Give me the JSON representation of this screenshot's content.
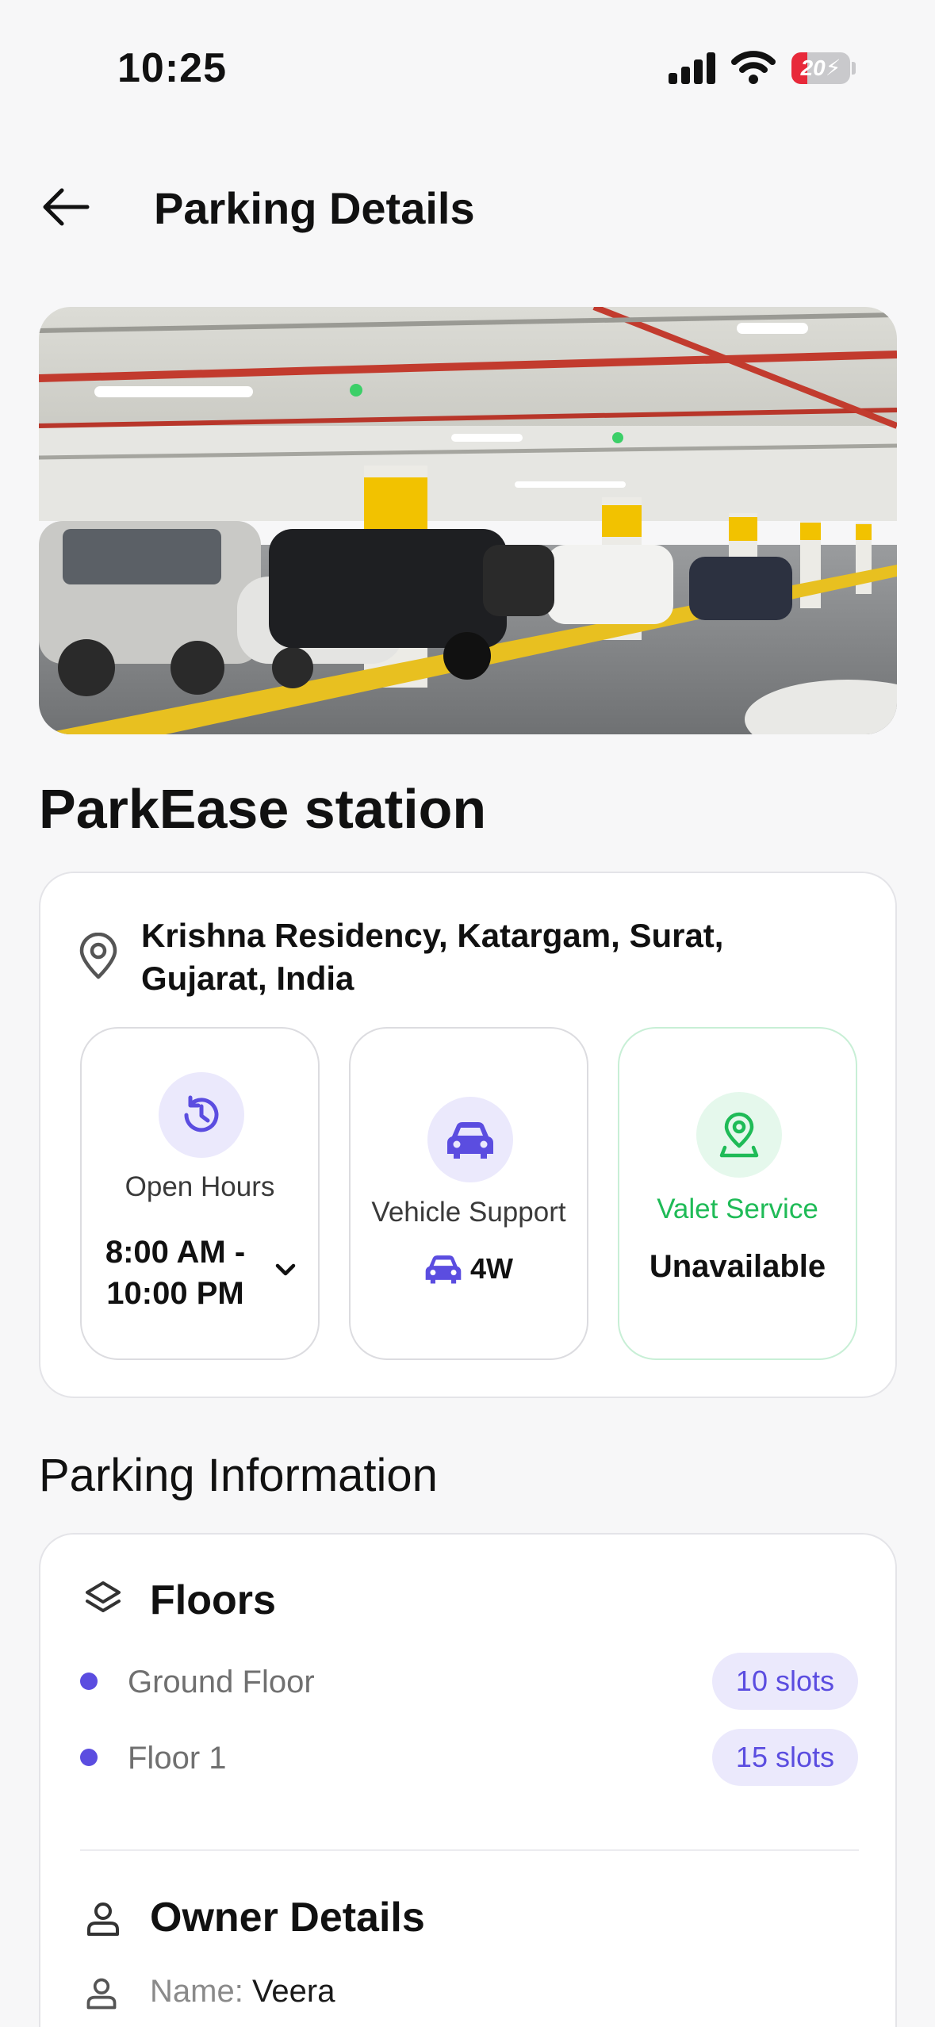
{
  "status_bar": {
    "time": "10:25",
    "battery": "20"
  },
  "header": {
    "title": "Parking Details"
  },
  "station": {
    "name": "ParkEase station"
  },
  "location": {
    "address": "Krishna Residency, Katargam, Surat, Gujarat, India",
    "tiles": {
      "hours": {
        "label": "Open Hours",
        "value": "8:00 AM - 10:00 PM"
      },
      "vehicle": {
        "label": "Vehicle Support",
        "value": "4W"
      },
      "valet": {
        "label": "Valet Service",
        "value": "Unavailable"
      }
    }
  },
  "parking_info": {
    "section_title": "Parking Information",
    "floors_title": "Floors",
    "floors": [
      {
        "name": "Ground Floor",
        "slots": "10 slots"
      },
      {
        "name": "Floor 1",
        "slots": "15 slots"
      }
    ],
    "owner_title": "Owner Details",
    "owner_name_label": "Name:",
    "owner_name_value": "Veera"
  },
  "colors": {
    "accent": "#5b4de0",
    "accent_light": "#ebe9fc",
    "valet_green": "#1fbb57",
    "battery_low": "#e8293a",
    "parking_yellow": "#f2c200"
  },
  "icons": [
    "back-arrow-icon",
    "location-pin-icon",
    "history-clock-icon",
    "car-icon",
    "valet-pin-icon",
    "chevron-down-icon",
    "layers-icon",
    "user-icon"
  ]
}
